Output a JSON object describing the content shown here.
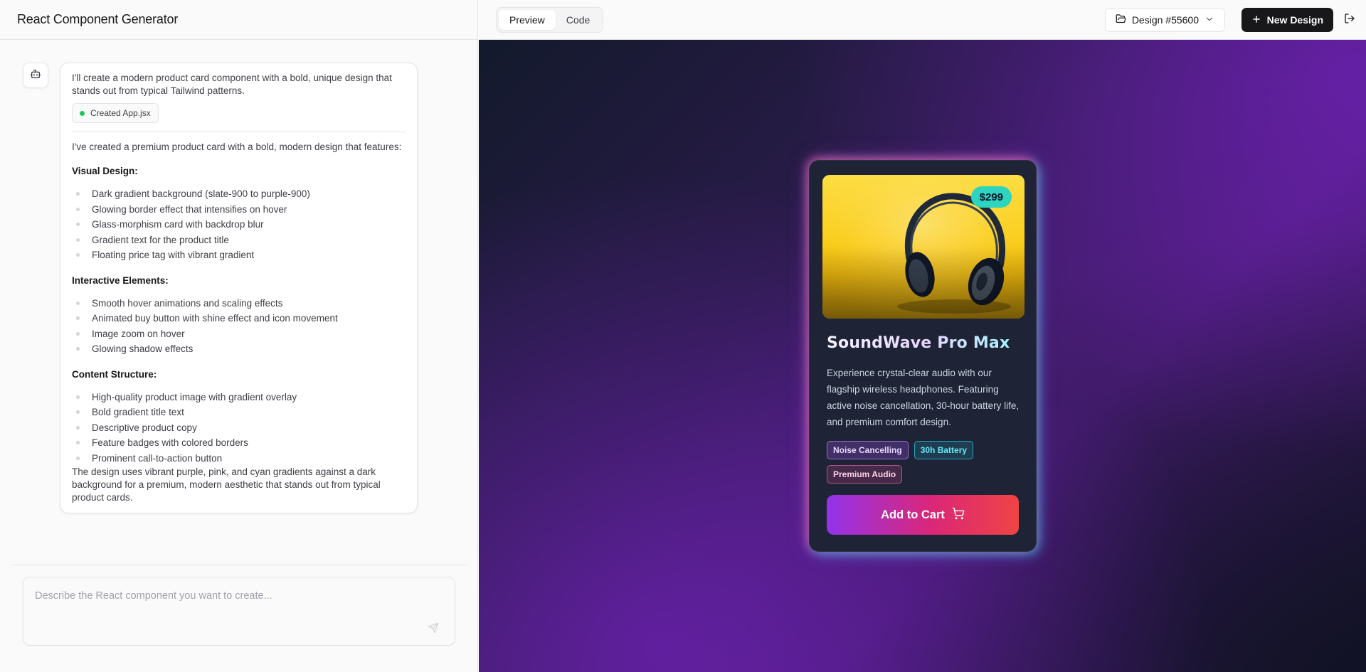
{
  "app": {
    "title": "React Component Generator"
  },
  "chat": {
    "message": {
      "intro": "I'll create a modern product card component with a bold, unique design that stands out from typical Tailwind patterns.",
      "file_chip": "Created App.jsx",
      "summary": "I've created a premium product card with a bold, modern design that features:",
      "sections": [
        {
          "title": "Visual Design:",
          "items": [
            "Dark gradient background (slate-900 to purple-900)",
            "Glowing border effect that intensifies on hover",
            "Glass-morphism card with backdrop blur",
            "Gradient text for the product title",
            "Floating price tag with vibrant gradient"
          ]
        },
        {
          "title": "Interactive Elements:",
          "items": [
            "Smooth hover animations and scaling effects",
            "Animated buy button with shine effect and icon movement",
            "Image zoom on hover",
            "Glowing shadow effects"
          ]
        },
        {
          "title": "Content Structure:",
          "items": [
            "High-quality product image with gradient overlay",
            "Bold gradient title text",
            "Descriptive product copy",
            "Feature badges with colored borders",
            "Prominent call-to-action button"
          ]
        }
      ],
      "closing": "The design uses vibrant purple, pink, and cyan gradients against a dark background for a premium, modern aesthetic that stands out from typical product cards."
    },
    "input": {
      "placeholder": "Describe the React component you want to create...",
      "value": ""
    }
  },
  "toolbar": {
    "tabs": [
      {
        "label": "Preview",
        "active": true
      },
      {
        "label": "Code",
        "active": false
      }
    ],
    "design_select": "Design #55600",
    "new_design": "New Design"
  },
  "preview": {
    "product": {
      "price": "$299",
      "title": "SoundWave Pro Max",
      "description": "Experience crystal-clear audio with our flagship wireless headphones. Featuring active noise cancellation, 30-hour battery life, and premium comfort design.",
      "badges": [
        {
          "label": "Noise Cancelling",
          "color": "#a855f7"
        },
        {
          "label": "30h Battery",
          "color": "#22d3ee"
        },
        {
          "label": "Premium Audio",
          "color": "#ec4899"
        }
      ],
      "cta": "Add to Cart"
    }
  },
  "colors": {
    "accent_dark": "#18181b",
    "status_green": "#22c55e",
    "price_tag": "#2dd4bf"
  }
}
